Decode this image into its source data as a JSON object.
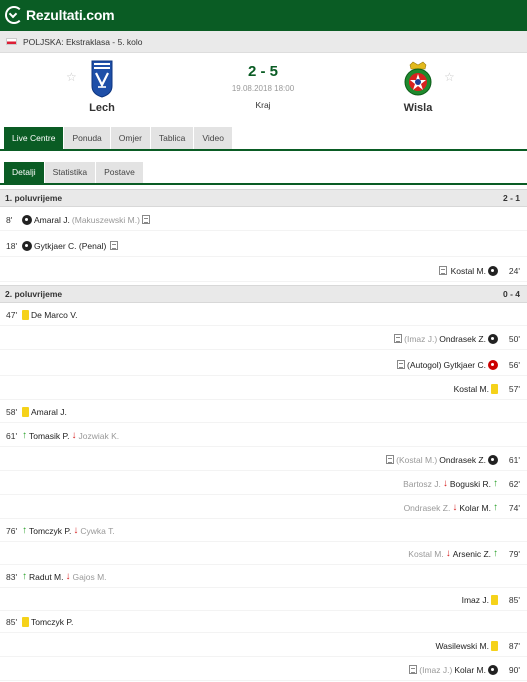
{
  "brand": {
    "name": "Rezultati.com"
  },
  "league": {
    "label": "POLJSKA: Ekstraklasa - 5. kolo"
  },
  "match": {
    "home": {
      "name": "Lech",
      "icon": "lech-crest-icon"
    },
    "away": {
      "name": "Wisla",
      "icon": "wisla-crest-icon"
    },
    "score": "2 - 5",
    "date": "19.08.2018 18:00",
    "status": "Kraj"
  },
  "tabs": [
    "Live Centre",
    "Ponuda",
    "Omjer",
    "Tablica",
    "Video"
  ],
  "subtabs": [
    "Detalji",
    "Statistika",
    "Postave"
  ],
  "sections": {
    "first": {
      "title": "1. poluvrijeme",
      "score": "2 - 1"
    },
    "second": {
      "title": "2. poluvrijeme",
      "score": "0 - 4"
    }
  },
  "events": {
    "e1": {
      "minute": "8'",
      "player": "Amaral J.",
      "extra": "(Makuszewski M.)"
    },
    "e2": {
      "minute": "18'",
      "player": "Gytkjaer C. (Penal)"
    },
    "e3": {
      "minute": "24'",
      "player": "Kostal M."
    },
    "e4": {
      "minute": "47'",
      "player": "De Marco V."
    },
    "e5": {
      "minute": "50'",
      "player": "Ondrasek Z.",
      "extra": "(Imaz J.)"
    },
    "e6": {
      "minute": "56'",
      "player": "Gytkjaer C.",
      "extra": "(Autogol)"
    },
    "e7": {
      "minute": "57'",
      "player": "Kostal M."
    },
    "e8": {
      "minute": "58'",
      "player": "Amaral J."
    },
    "e9": {
      "minute": "61'",
      "in": "Tomasik P.",
      "out": "Jozwiak K."
    },
    "e10": {
      "minute": "61'",
      "player": "Ondrasek Z.",
      "extra": "(Kostal M.)"
    },
    "e11": {
      "minute": "62'",
      "in": "Boguski R.",
      "out": "Bartosz J."
    },
    "e12": {
      "minute": "74'",
      "in": "Kolar M.",
      "out": "Ondrasek Z."
    },
    "e13": {
      "minute": "76'",
      "in": "Tomczyk P.",
      "out": "Cywka T."
    },
    "e14": {
      "minute": "79'",
      "in": "Arsenic Z.",
      "out": "Kostal M."
    },
    "e15": {
      "minute": "83'",
      "in": "Radut M.",
      "out": "Gajos M."
    },
    "e16": {
      "minute": "85'",
      "player": "Imaz J."
    },
    "e17": {
      "minute": "85'",
      "player": "Tomczyk P."
    },
    "e18": {
      "minute": "87'",
      "player": "Wasilewski M."
    },
    "e19": {
      "minute": "90'",
      "player": "Kolar M.",
      "extra": "(Imaz J.)"
    }
  },
  "colors": {
    "brand_green": "#0a5c24",
    "yellow_card": "#f5d21a",
    "sub_in": "#2aa12a",
    "sub_out": "#d62020"
  }
}
